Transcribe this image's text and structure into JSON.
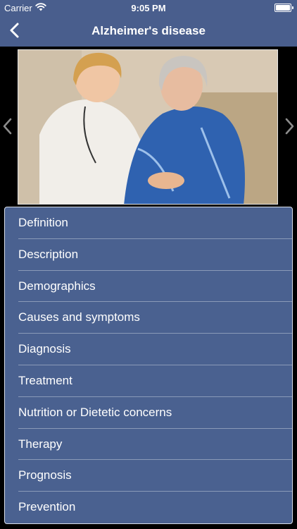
{
  "status_bar": {
    "carrier": "Carrier",
    "wifi_icon": "wifi-icon",
    "time": "9:05 PM",
    "battery_icon": "battery-icon"
  },
  "nav": {
    "title": "Alzheimer's disease",
    "back_icon": "chevron-left-icon"
  },
  "gallery": {
    "image": "photo of a nurse comforting an elderly woman",
    "prev_icon": "chevron-left-icon",
    "next_icon": "chevron-right-icon"
  },
  "menu": {
    "items": [
      {
        "label": "Definition"
      },
      {
        "label": "Description"
      },
      {
        "label": "Demographics"
      },
      {
        "label": "Causes and symptoms"
      },
      {
        "label": "Diagnosis"
      },
      {
        "label": "Treatment"
      },
      {
        "label": "Nutrition or Dietetic concerns"
      },
      {
        "label": "Therapy"
      },
      {
        "label": "Prognosis"
      },
      {
        "label": "Prevention"
      }
    ]
  },
  "colors": {
    "bar": "#495e8d",
    "menu_bg": "#4a6190",
    "background": "#000000"
  }
}
